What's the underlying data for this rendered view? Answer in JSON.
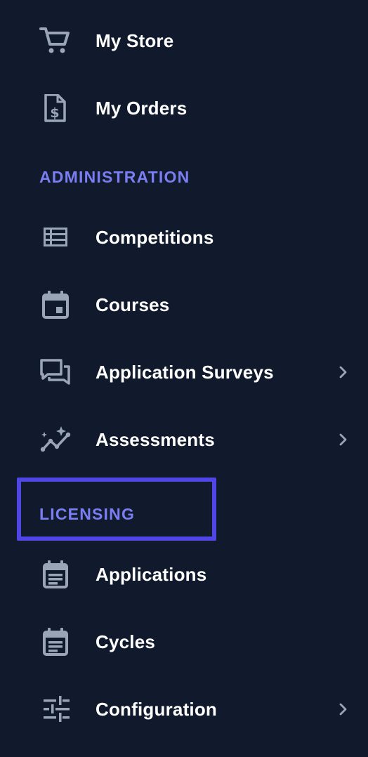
{
  "menu": {
    "items_top": [
      {
        "label": "My Store",
        "icon": "cart-icon"
      },
      {
        "label": "My Orders",
        "icon": "invoice-dollar-icon"
      }
    ],
    "administration": {
      "heading": "ADMINISTRATION",
      "items": [
        {
          "label": "Competitions",
          "icon": "list-table-icon"
        },
        {
          "label": "Courses",
          "icon": "calendar-event-icon"
        },
        {
          "label": "Application Surveys",
          "icon": "chat-bubbles-icon",
          "has_submenu": true
        },
        {
          "label": "Assessments",
          "icon": "sparkle-line-chart-icon",
          "has_submenu": true
        }
      ]
    },
    "licensing": {
      "heading": "LICENSING",
      "items": [
        {
          "label": "Applications",
          "icon": "calendar-notes-icon"
        },
        {
          "label": "Cycles",
          "icon": "calendar-notes-icon"
        },
        {
          "label": "Configuration",
          "icon": "sliders-icon",
          "has_submenu": true
        }
      ]
    }
  },
  "colors": {
    "background": "#111a2c",
    "text": "#ffffff",
    "heading": "#7b7ef2",
    "icon": "#9aa6b8",
    "focus_outline": "#4f46e5"
  }
}
